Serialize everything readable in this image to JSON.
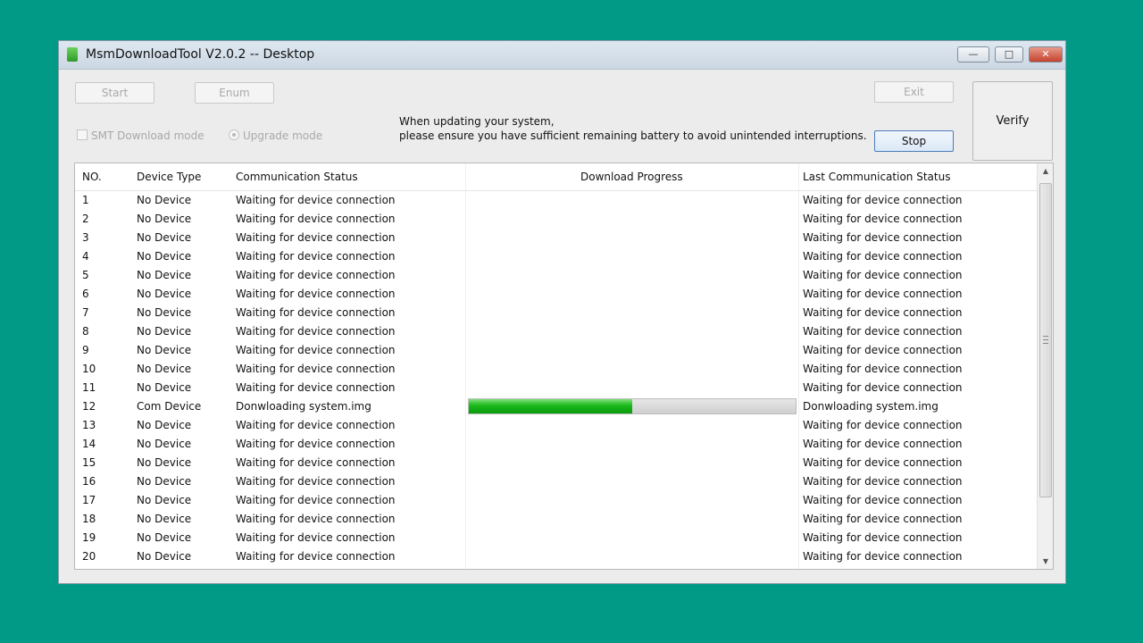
{
  "window": {
    "title": "MsmDownloadTool V2.0.2 -- Desktop",
    "controls": {
      "minimize": "—",
      "maximize": "□",
      "close": "✕"
    }
  },
  "toolbar": {
    "start_label": "Start",
    "enum_label": "Enum",
    "exit_label": "Exit",
    "stop_label": "Stop",
    "verify_label": "Verify",
    "smt_mode_label": "SMT Download mode",
    "upgrade_mode_label": "Upgrade mode"
  },
  "notice": {
    "line1": "When updating your system,",
    "line2": "please ensure you have sufficient remaining battery to avoid unintended interruptions."
  },
  "table": {
    "columns": [
      "NO.",
      "Device Type",
      "Communication Status",
      "Download Progress",
      "Last Communication Status"
    ],
    "rows": [
      {
        "no": "1",
        "type": "No Device",
        "comm": "Waiting for device connection",
        "last": "Waiting for device connection"
      },
      {
        "no": "2",
        "type": "No Device",
        "comm": "Waiting for device connection",
        "last": "Waiting for device connection"
      },
      {
        "no": "3",
        "type": "No Device",
        "comm": "Waiting for device connection",
        "last": "Waiting for device connection"
      },
      {
        "no": "4",
        "type": "No Device",
        "comm": "Waiting for device connection",
        "last": "Waiting for device connection"
      },
      {
        "no": "5",
        "type": "No Device",
        "comm": "Waiting for device connection",
        "last": "Waiting for device connection"
      },
      {
        "no": "6",
        "type": "No Device",
        "comm": "Waiting for device connection",
        "last": "Waiting for device connection"
      },
      {
        "no": "7",
        "type": "No Device",
        "comm": "Waiting for device connection",
        "last": "Waiting for device connection"
      },
      {
        "no": "8",
        "type": "No Device",
        "comm": "Waiting for device connection",
        "last": "Waiting for device connection"
      },
      {
        "no": "9",
        "type": "No Device",
        "comm": "Waiting for device connection",
        "last": "Waiting for device connection"
      },
      {
        "no": "10",
        "type": "No Device",
        "comm": "Waiting for device connection",
        "last": "Waiting for device connection"
      },
      {
        "no": "11",
        "type": "No Device",
        "comm": "Waiting for device connection",
        "last": "Waiting for device connection"
      },
      {
        "no": "12",
        "type": "Com Device",
        "comm": "Donwloading system.img",
        "last": "Donwloading system.img",
        "progress": 0.5
      },
      {
        "no": "13",
        "type": "No Device",
        "comm": "Waiting for device connection",
        "last": "Waiting for device connection"
      },
      {
        "no": "14",
        "type": "No Device",
        "comm": "Waiting for device connection",
        "last": "Waiting for device connection"
      },
      {
        "no": "15",
        "type": "No Device",
        "comm": "Waiting for device connection",
        "last": "Waiting for device connection"
      },
      {
        "no": "16",
        "type": "No Device",
        "comm": "Waiting for device connection",
        "last": "Waiting for device connection"
      },
      {
        "no": "17",
        "type": "No Device",
        "comm": "Waiting for device connection",
        "last": "Waiting for device connection"
      },
      {
        "no": "18",
        "type": "No Device",
        "comm": "Waiting for device connection",
        "last": "Waiting for device connection"
      },
      {
        "no": "19",
        "type": "No Device",
        "comm": "Waiting for device connection",
        "last": "Waiting for device connection"
      },
      {
        "no": "20",
        "type": "No Device",
        "comm": "Waiting for device connection",
        "last": "Waiting for device connection"
      }
    ]
  },
  "colors": {
    "background": "#009a86",
    "progress_fill": "#19b81a"
  },
  "icons": {
    "app": "app-icon",
    "scroll_up": "▲",
    "scroll_down": "▼"
  }
}
